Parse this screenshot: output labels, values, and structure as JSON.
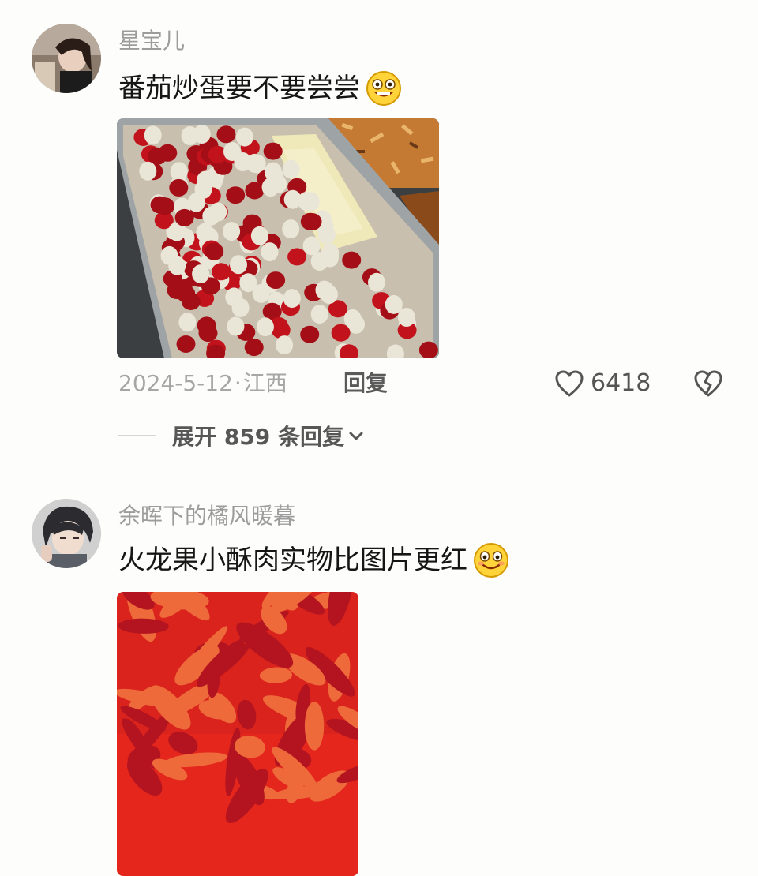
{
  "comments": [
    {
      "username": "星宝儿",
      "text": "番茄炒蛋要不要尝尝",
      "emoji_icon": "laughing-face-emoji",
      "photo_description_icon": "food-tray-photo",
      "date": "2024-5-12",
      "separator": "·",
      "location": "江西",
      "reply_label": "回复",
      "like_count": "6418",
      "expand_label": "展开 859 条回复"
    },
    {
      "username": "余晖下的橘风暖暮",
      "text": "火龙果小酥肉实物比图片更红",
      "emoji_icon": "smiling-face-emoji",
      "photo_description_icon": "red-fried-pork-photo"
    }
  ],
  "colors": {
    "username": "#9c9c9c",
    "meta": "#a6a6a6",
    "accent_dark": "#555555",
    "background": "#fdfdfb"
  }
}
